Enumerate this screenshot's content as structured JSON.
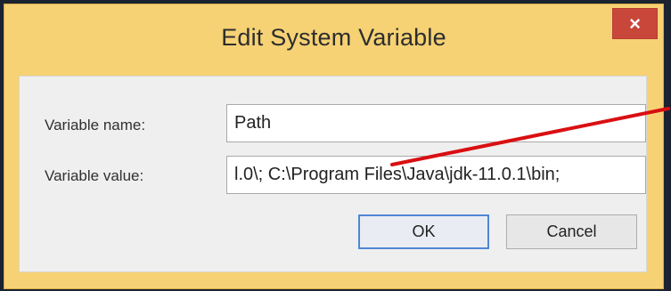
{
  "window": {
    "title": "Edit System Variable",
    "close_label": "×"
  },
  "form": {
    "name_label": "Variable name:",
    "name_value": "Path",
    "value_label": "Variable value:",
    "value_value": "l.0\\; C:\\Program Files\\Java\\jdk-11.0.1\\bin;"
  },
  "buttons": {
    "ok_label": "OK",
    "cancel_label": "Cancel"
  },
  "icons": {
    "close": "close-icon"
  },
  "colors": {
    "frame": "#f6d275",
    "close": "#c9473a",
    "annotation": "#d90f12",
    "background": "#1b2230"
  }
}
